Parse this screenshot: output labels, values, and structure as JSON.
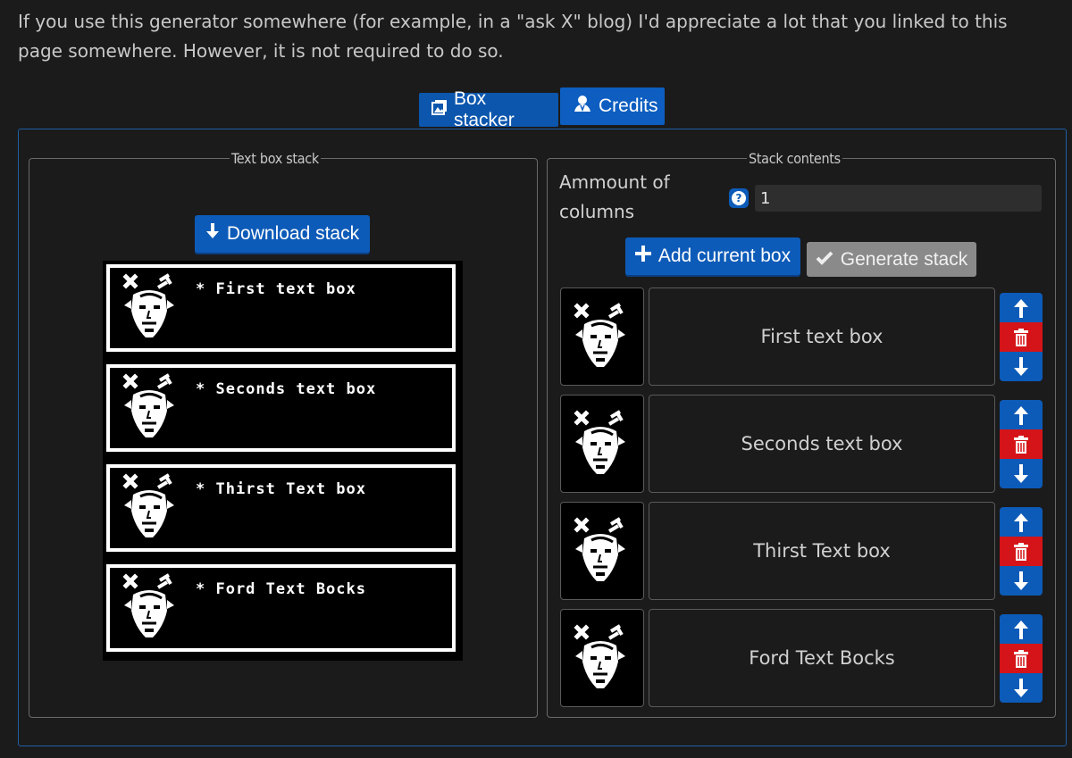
{
  "intro": {
    "text": "If you use this generator somewhere (for example, in a \"ask X\" blog) I'd appreciate a lot that you linked to this page somewhere. However, it is not required to do so."
  },
  "tabs": [
    {
      "label": "Box stacker",
      "icon": "images-icon"
    },
    {
      "label": "Credits",
      "icon": "user-icon"
    }
  ],
  "left_panel": {
    "legend": "Text box stack",
    "download_label": "Download stack",
    "stack_boxes": [
      {
        "text": "* First text box"
      },
      {
        "text": "* Seconds text box"
      },
      {
        "text": "* Thirst Text box"
      },
      {
        "text": "* Ford Text Bocks"
      }
    ]
  },
  "right_panel": {
    "legend": "Stack contents",
    "columns_label": "Ammount of columns",
    "columns_value": "1",
    "add_label": "Add current box",
    "generate_label": "Generate stack",
    "rows": [
      {
        "text": "First text box"
      },
      {
        "text": "Seconds text box"
      },
      {
        "text": "Thirst Text box"
      },
      {
        "text": "Ford Text Bocks"
      }
    ]
  },
  "colors": {
    "accent": "#0d5bb8",
    "danger": "#d41418",
    "disabled": "#8a8a8a",
    "background": "#1b1b1c"
  }
}
